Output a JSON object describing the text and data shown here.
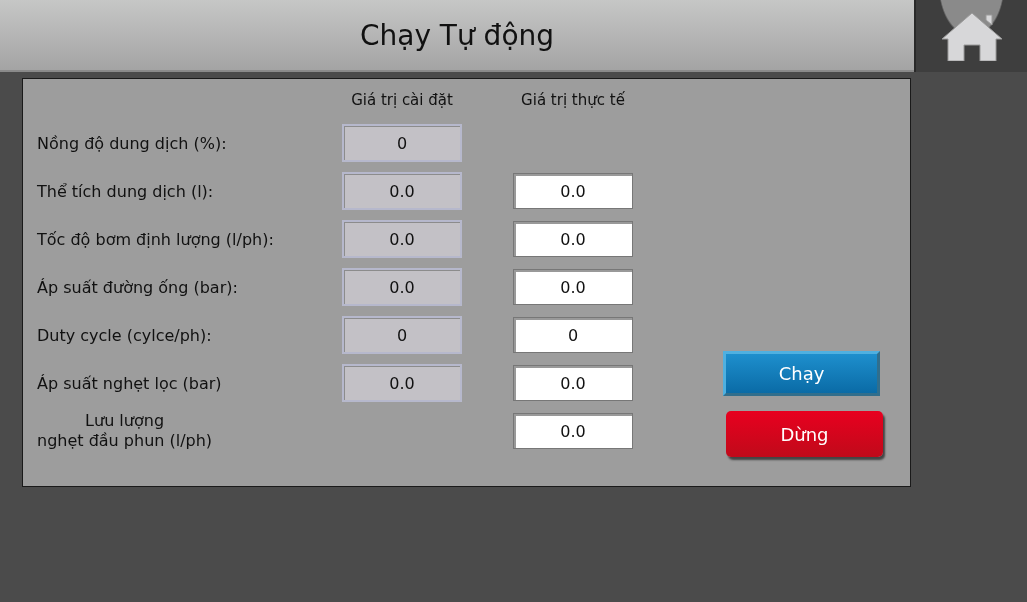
{
  "header": {
    "title": "Chạy Tự động"
  },
  "columns": [
    "Giá trị cài đặt",
    "Giá trị thực tế"
  ],
  "rows": [
    {
      "label": "Nồng độ dung dịch (%):",
      "setpoint": "0"
    },
    {
      "label": "Thể tích dung dịch (l):",
      "setpoint": "0.0",
      "actual": "0.0"
    },
    {
      "label": "Tốc độ bơm định lượng (l/ph):",
      "setpoint": "0.0",
      "actual": "0.0"
    },
    {
      "label": "Áp suất đường ống (bar):",
      "setpoint": "0.0",
      "actual": "0.0"
    },
    {
      "label": "Duty cycle (cylce/ph):",
      "setpoint": "0",
      "actual": "0"
    },
    {
      "label": "Áp suất nghẹt lọc (bar)",
      "setpoint": "0.0",
      "actual": "0.0"
    },
    {
      "label": "Lưu lượng\nnghẹt đầu phun (l/ph)",
      "actual": "0.0"
    }
  ],
  "buttons": [
    {
      "label": "Chạy",
      "kind": "run"
    },
    {
      "label": "Dừng",
      "kind": "stop"
    }
  ]
}
